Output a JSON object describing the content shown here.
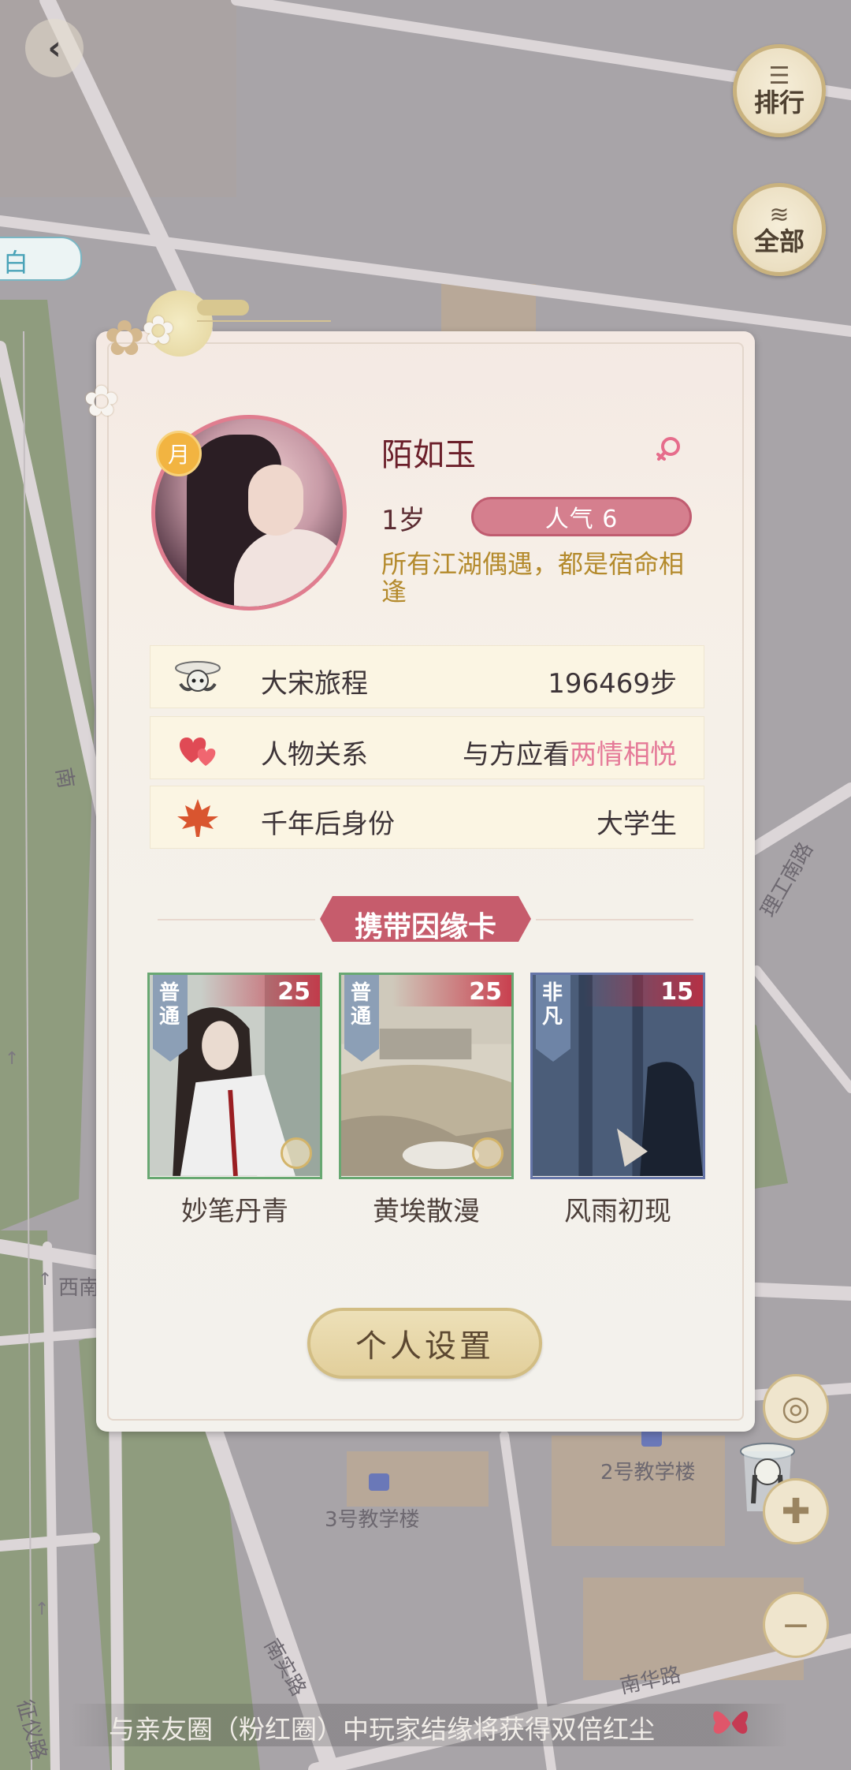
{
  "top_controls": {
    "back_icon": "‹",
    "ranking_label": "排行",
    "all_label": "全部",
    "side_tag": "白"
  },
  "map_labels": {
    "building_2": "2号教学楼",
    "building_3": "3号教学楼",
    "road_nanhua": "南华路",
    "road_ligong_south": "理工南路",
    "road_nanshi": "南实路",
    "road_zhengyi": "征仪路",
    "road_xinan": "西南",
    "road_nan": "南"
  },
  "profile": {
    "badge": "月",
    "name": "陌如玉",
    "gender": "female",
    "age": "1岁",
    "popularity": "人气 6",
    "motto": "所有江湖偶遇，都是宿命相逢"
  },
  "info": [
    {
      "key": "大宋旅程",
      "value": "196469步",
      "icon": "traveler-icon"
    },
    {
      "key": "人物关系",
      "value": "与方应看",
      "highlight": "两情相悦",
      "icon": "hearts-icon"
    },
    {
      "key": "千年后身份",
      "value": "大学生",
      "icon": "maple-leaf-icon"
    }
  ],
  "section_title": "携带因缘卡",
  "cards": [
    {
      "name": "妙笔丹青",
      "rarity": "普通",
      "level": "25"
    },
    {
      "name": "黄埃散漫",
      "rarity": "普通",
      "level": "25"
    },
    {
      "name": "风雨初现",
      "rarity": "非凡",
      "level": "15"
    }
  ],
  "settings_label": "个人设置",
  "notice": "与亲友圈（粉红圈）中玩家结缘将获得双倍红尘",
  "colors": {
    "accent_pink": "#d57f8e",
    "highlight_pink": "#e57a98",
    "motto_gold": "#b48a2c",
    "name_red": "#6b1f2a"
  }
}
